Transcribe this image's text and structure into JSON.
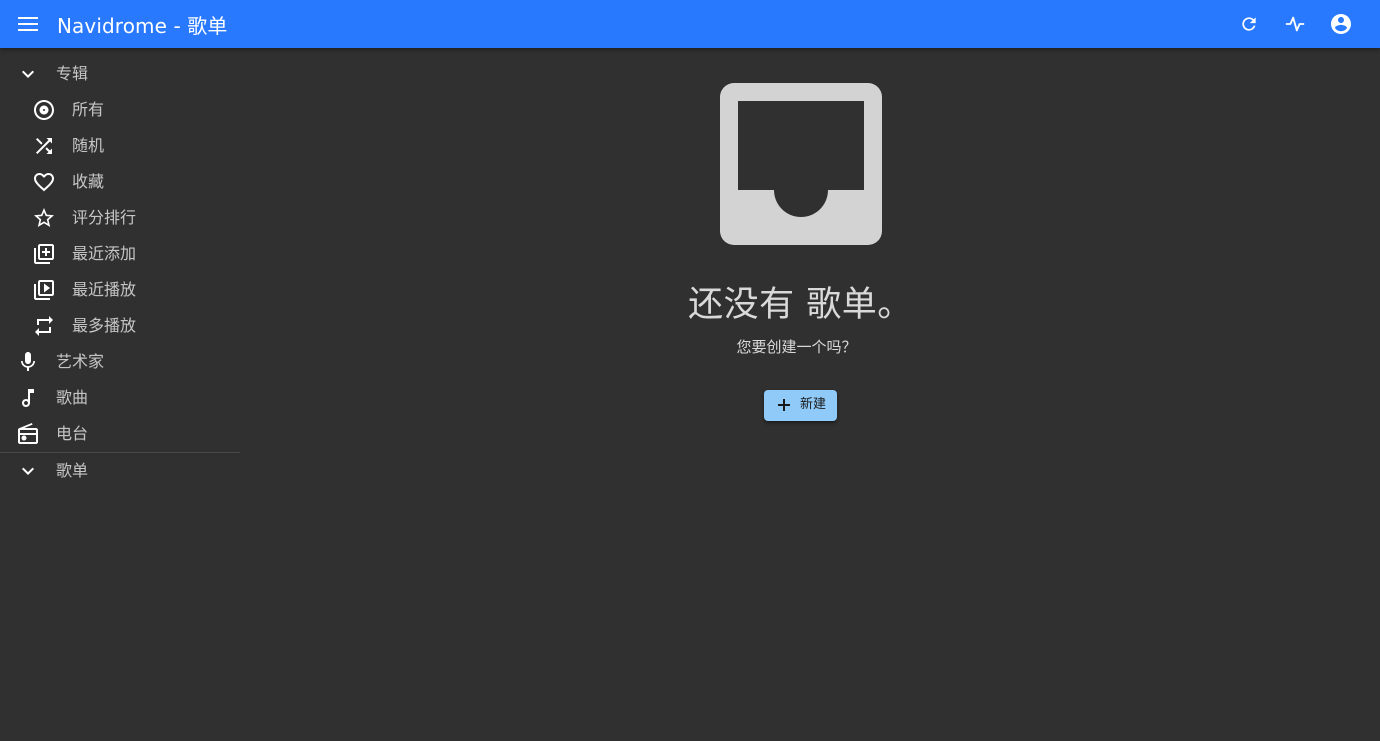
{
  "appbar": {
    "title": "Navidrome - 歌单",
    "icons": [
      "menu-icon",
      "refresh-icon",
      "activity-icon",
      "account-icon"
    ]
  },
  "sidebar": {
    "albums_header": "专辑",
    "album_items": [
      {
        "label": "所有",
        "icon": "album-icon"
      },
      {
        "label": "随机",
        "icon": "shuffle-icon"
      },
      {
        "label": "收藏",
        "icon": "heart-icon"
      },
      {
        "label": "评分排行",
        "icon": "star-icon"
      },
      {
        "label": "最近添加",
        "icon": "library-add-icon"
      },
      {
        "label": "最近播放",
        "icon": "video-library-icon"
      },
      {
        "label": "最多播放",
        "icon": "repeat-icon"
      }
    ],
    "top_items": [
      {
        "label": "艺术家",
        "icon": "mic-icon"
      },
      {
        "label": "歌曲",
        "icon": "music-note-icon"
      },
      {
        "label": "电台",
        "icon": "radio-icon"
      }
    ],
    "playlists_header": "歌单"
  },
  "main": {
    "empty_title": "还没有 歌单。",
    "empty_subtitle": "您要创建一个吗？",
    "create_label": "新建",
    "art_color": "#d3d3d3"
  },
  "colors": {
    "appbar": "#2979ff",
    "background": "#303030",
    "button": "#90caf9"
  }
}
